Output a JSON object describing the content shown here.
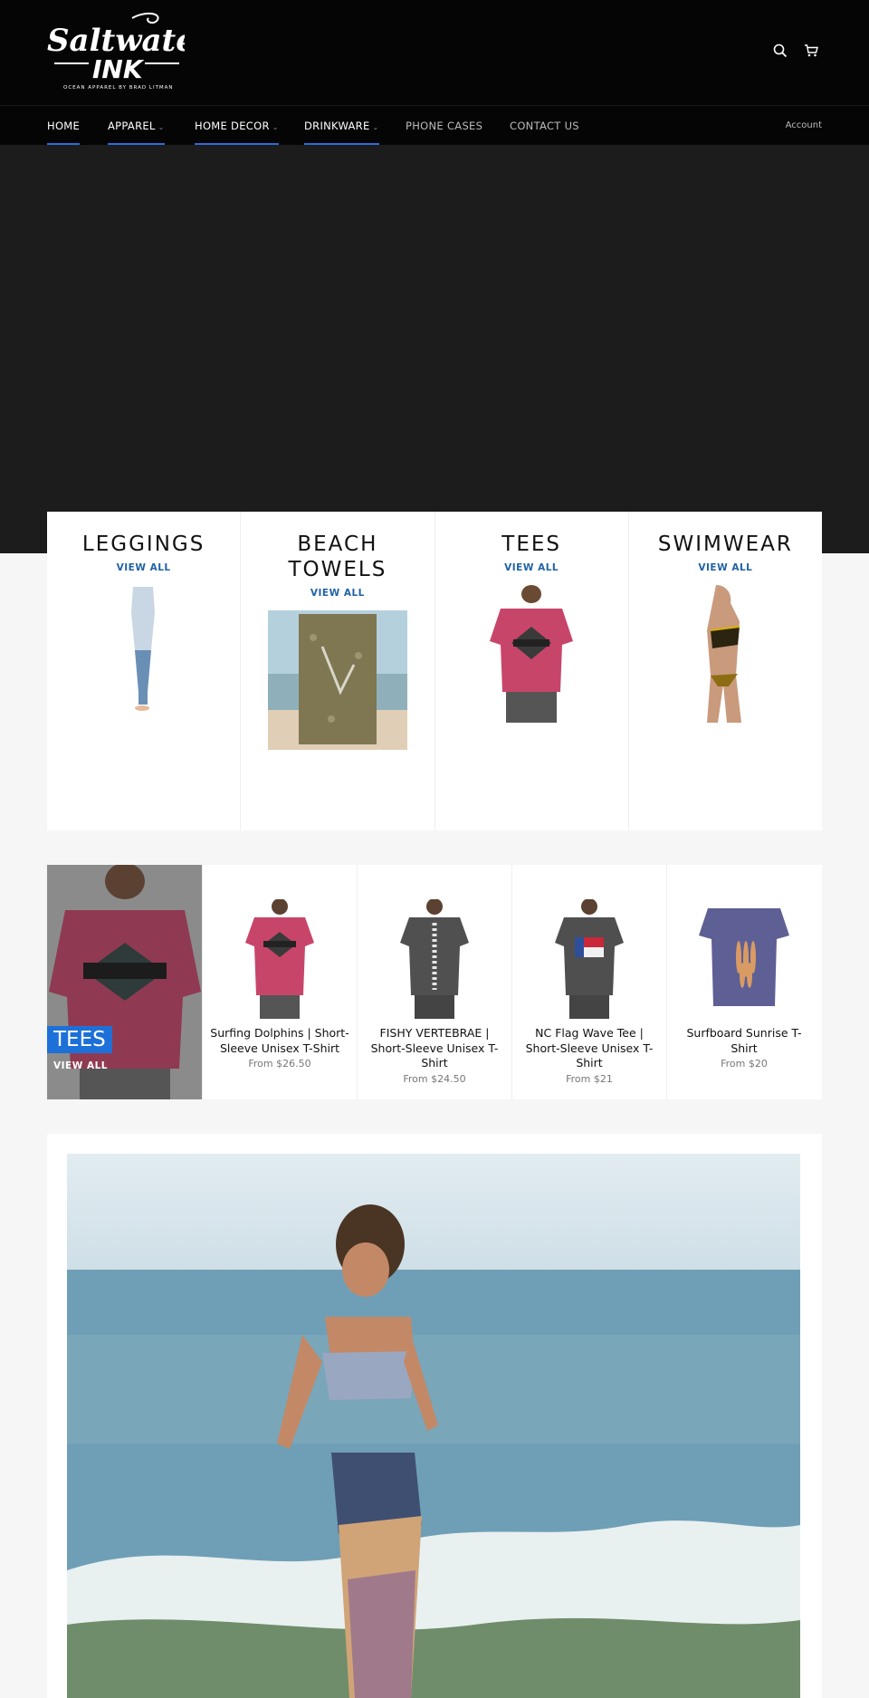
{
  "header": {
    "logo_text": "Saltwater INK",
    "logo_tagline": "OCEAN APPAREL BY BRAD LITMAN"
  },
  "nav": {
    "items": [
      {
        "label": "HOME"
      },
      {
        "label": "APPAREL"
      },
      {
        "label": "HOME DECOR"
      },
      {
        "label": "DRINKWARE"
      },
      {
        "label": "PHONE CASES"
      },
      {
        "label": "CONTACT US"
      }
    ],
    "account_label": "Account"
  },
  "categories": [
    {
      "title": "LEGGINGS",
      "link": "VIEW ALL"
    },
    {
      "title": "BEACH TOWELS",
      "link": "VIEW ALL"
    },
    {
      "title": "TEES",
      "link": "VIEW ALL"
    },
    {
      "title": "SWIMWEAR",
      "link": "VIEW ALL"
    }
  ],
  "featured": {
    "badge": "TEES",
    "link": "VIEW ALL",
    "products": [
      {
        "name": "Surfing Dolphins | Short-Sleeve Unisex T-Shirt",
        "price": "From $26.50"
      },
      {
        "name": "FISHY VERTEBRAE | Short-Sleeve Unisex T-Shirt",
        "price": "From $24.50"
      },
      {
        "name": "NC Flag Wave Tee | Short-Sleeve Unisex T-Shirt",
        "price": "From $21"
      },
      {
        "name": "Surfboard Sunrise T-Shirt",
        "price": "From $20"
      }
    ]
  },
  "colors": {
    "accent": "#2a6dd8",
    "link": "#2062a8",
    "badge": "#1d70d8",
    "header_bg": "#050505",
    "hero_bg": "#1c1c1c"
  },
  "icons": [
    "search-icon",
    "cart-icon",
    "chevron-down-icon"
  ]
}
